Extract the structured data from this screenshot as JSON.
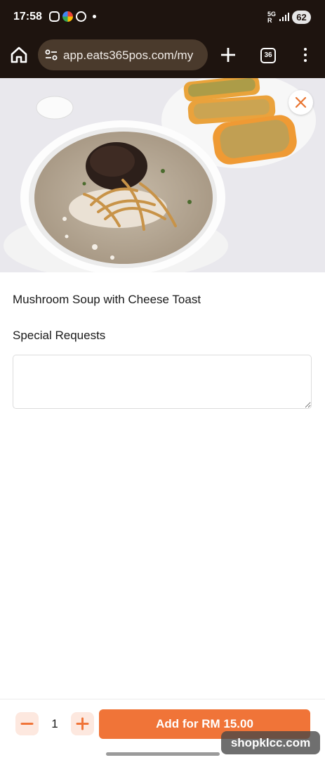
{
  "status_bar": {
    "time": "17:58",
    "network": "5G",
    "network_sub": "R",
    "battery": "62"
  },
  "browser": {
    "url": "app.eats365pos.com/my",
    "tab_count": "36"
  },
  "item": {
    "name": "Mushroom Soup with Cheese Toast",
    "special_requests_label": "Special Requests",
    "special_requests_value": "",
    "special_requests_placeholder": ""
  },
  "order": {
    "quantity": "1",
    "add_label": "Add for RM 15.00"
  },
  "watermark": "shopklcc.com",
  "colors": {
    "accent": "#f07438",
    "accent_light": "#fde8df",
    "chrome": "#1e140f"
  }
}
